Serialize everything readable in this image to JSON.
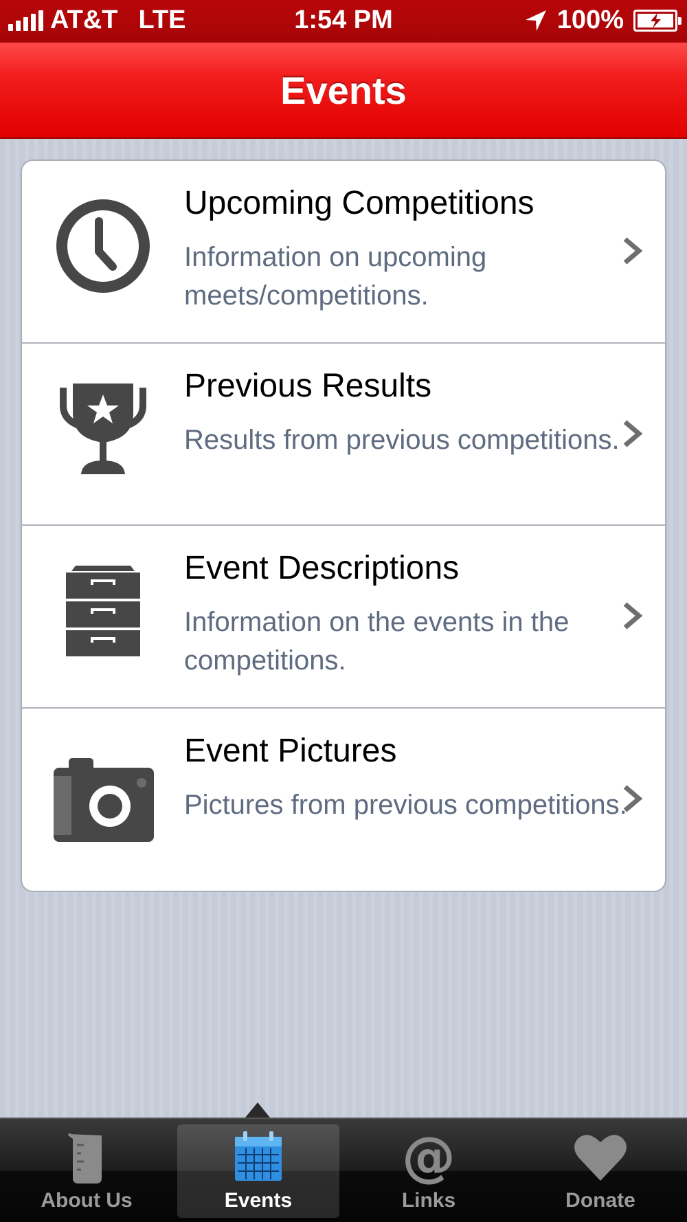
{
  "status_bar": {
    "carrier": "AT&T",
    "network": "LTE",
    "time": "1:54 PM",
    "battery": "100%"
  },
  "nav": {
    "title": "Events"
  },
  "rows": [
    {
      "title": "Upcoming Competitions",
      "subtitle": "Information on upcoming meets/competitions.",
      "icon": "clock-icon"
    },
    {
      "title": "Previous Results",
      "subtitle": "Results from previous competitions.",
      "icon": "trophy-icon"
    },
    {
      "title": "Event Descriptions",
      "subtitle": "Information on the events in the competitions.",
      "icon": "file-cabinet-icon"
    },
    {
      "title": "Event Pictures",
      "subtitle": "Pictures from previous competitions.",
      "icon": "camera-icon"
    }
  ],
  "tabs": [
    {
      "label": "About Us",
      "icon": "beaker-icon",
      "active": false
    },
    {
      "label": "Events",
      "icon": "calendar-icon",
      "active": true
    },
    {
      "label": "Links",
      "icon": "at-sign-icon",
      "active": false
    },
    {
      "label": "Donate",
      "icon": "heart-icon",
      "active": false
    }
  ],
  "colors": {
    "nav_red": "#e10000",
    "status_bar_red": "#a60407",
    "subtitle_gray": "#5f6b80",
    "active_tab_blue": "#3aa0e8"
  }
}
